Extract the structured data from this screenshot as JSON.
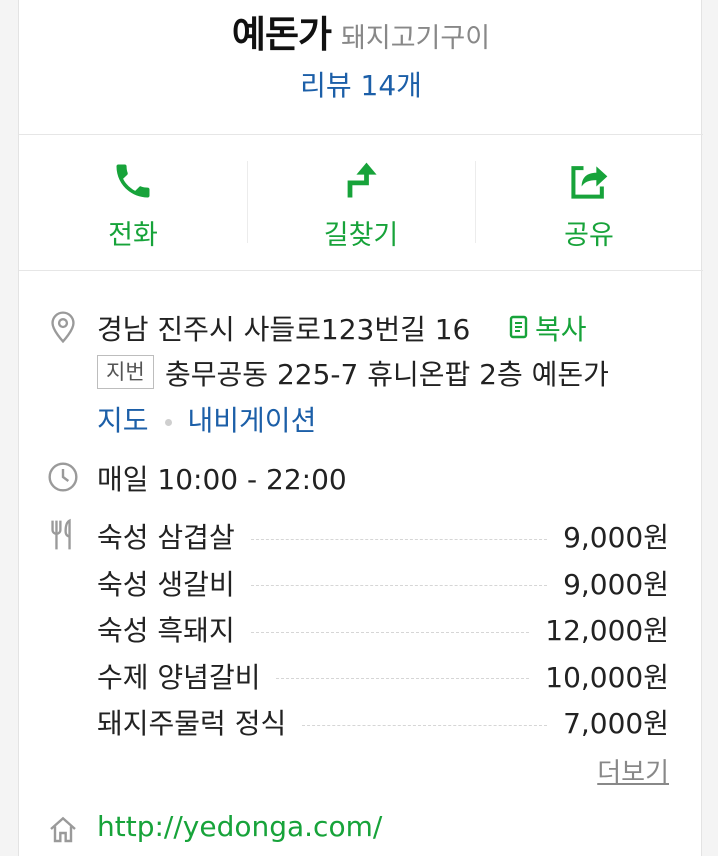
{
  "place": {
    "name": "예돈가",
    "category": "돼지고기구이",
    "review_label": "리뷰 14개"
  },
  "actions": {
    "call_label": "전화",
    "directions_label": "길찾기",
    "share_label": "공유"
  },
  "address": {
    "road": "경남 진주시 사들로123번길 16",
    "copy_label": "복사",
    "jibun_badge": "지번",
    "jibun": "충무공동 225-7 휴니온팝 2층 예돈가",
    "map_link": "지도",
    "navigation_link": "내비게이션"
  },
  "hours": {
    "text": "매일 10:00 - 22:00"
  },
  "menu": {
    "items": [
      {
        "name": "숙성 삼겹살",
        "price": "9,000원"
      },
      {
        "name": "숙성 생갈비",
        "price": "9,000원"
      },
      {
        "name": "숙성 흑돼지",
        "price": "12,000원"
      },
      {
        "name": "수제 양념갈비",
        "price": "10,000원"
      },
      {
        "name": "돼지주물럭 정식",
        "price": "7,000원"
      }
    ],
    "more_label": "더보기"
  },
  "homepage": {
    "url": "http://yedonga.com/"
  },
  "colors": {
    "accent_green": "#17a33a",
    "link_blue": "#1c5fa8",
    "muted_text": "#888888"
  }
}
